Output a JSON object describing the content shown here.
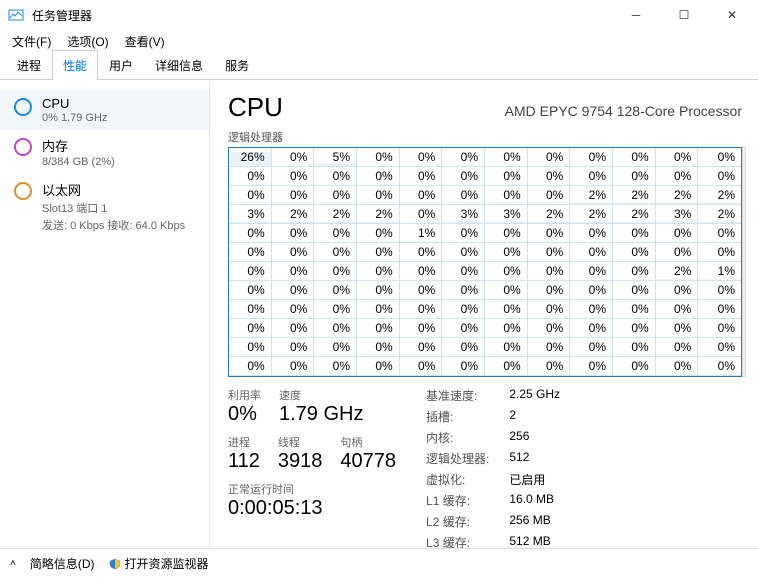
{
  "window": {
    "title": "任务管理器"
  },
  "menu": {
    "file": "文件(F)",
    "options": "选项(O)",
    "view": "查看(V)"
  },
  "tabs": {
    "processes": "进程",
    "performance": "性能",
    "users": "用户",
    "details": "详细信息",
    "services": "服务",
    "active": 1
  },
  "sidebar": [
    {
      "icon_color": "#1e88e5",
      "title": "CPU",
      "sub": "0% 1.79 GHz",
      "selected": true
    },
    {
      "icon_color": "#c049c0",
      "title": "内存",
      "sub": "8/384 GB (2%)"
    },
    {
      "icon_color": "#d89030",
      "title": "以太网",
      "sub": "Slot13 端口 1",
      "sub2": "发送: 0 Kbps 接收: 64.0 Kbps"
    }
  ],
  "cpu": {
    "heading": "CPU",
    "model": "AMD EPYC 9754 128-Core Processor",
    "cores_label": "逻辑处理器",
    "grid": [
      [
        26,
        0,
        5,
        0,
        0,
        0,
        0,
        0,
        0,
        0,
        0,
        0
      ],
      [
        0,
        0,
        0,
        0,
        0,
        0,
        0,
        0,
        0,
        0,
        0,
        0
      ],
      [
        0,
        0,
        0,
        0,
        0,
        0,
        0,
        0,
        2,
        2,
        2,
        2
      ],
      [
        3,
        2,
        2,
        2,
        0,
        3,
        3,
        2,
        2,
        2,
        3,
        2
      ],
      [
        0,
        0,
        0,
        0,
        1,
        0,
        0,
        0,
        0,
        0,
        0,
        0
      ],
      [
        0,
        0,
        0,
        0,
        0,
        0,
        0,
        0,
        0,
        0,
        0,
        0
      ],
      [
        0,
        0,
        0,
        0,
        0,
        0,
        0,
        0,
        0,
        0,
        2,
        1
      ],
      [
        0,
        0,
        0,
        0,
        0,
        0,
        0,
        0,
        0,
        0,
        0,
        0
      ],
      [
        0,
        0,
        0,
        0,
        0,
        0,
        0,
        0,
        0,
        0,
        0,
        0
      ],
      [
        0,
        0,
        0,
        0,
        0,
        0,
        0,
        0,
        0,
        0,
        0,
        0
      ],
      [
        0,
        0,
        0,
        0,
        0,
        0,
        0,
        0,
        0,
        0,
        0,
        0
      ],
      [
        0,
        0,
        0,
        0,
        0,
        0,
        0,
        0,
        0,
        0,
        0,
        0
      ]
    ],
    "statsL": {
      "util_label": "利用率",
      "util_val": "0%",
      "speed_label": "速度",
      "speed_val": "1.79 GHz",
      "proc_label": "进程",
      "proc_val": "112",
      "threads_label": "线程",
      "threads_val": "3918",
      "handles_label": "句柄",
      "handles_val": "40778",
      "uptime_label": "正常运行时间",
      "uptime_val": "0:00:05:13"
    },
    "statsR": [
      [
        "基准速度:",
        "2.25 GHz"
      ],
      [
        "插槽:",
        "2"
      ],
      [
        "内核:",
        "256"
      ],
      [
        "逻辑处理器:",
        "512"
      ],
      [
        "虚拟化:",
        "已启用"
      ],
      [
        "L1 缓存:",
        "16.0 MB"
      ],
      [
        "L2 缓存:",
        "256 MB"
      ],
      [
        "L3 缓存:",
        "512 MB"
      ]
    ]
  },
  "bottom": {
    "brief": "简略信息(D)",
    "resmon": "打开资源监视器"
  }
}
